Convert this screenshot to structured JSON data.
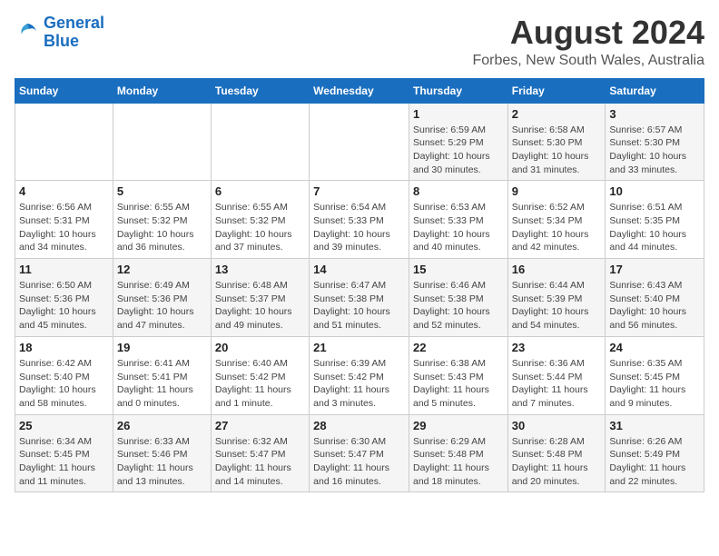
{
  "logo": {
    "line1": "General",
    "line2": "Blue"
  },
  "title": "August 2024",
  "subtitle": "Forbes, New South Wales, Australia",
  "days_of_week": [
    "Sunday",
    "Monday",
    "Tuesday",
    "Wednesday",
    "Thursday",
    "Friday",
    "Saturday"
  ],
  "weeks": [
    [
      {
        "day": "",
        "info": ""
      },
      {
        "day": "",
        "info": ""
      },
      {
        "day": "",
        "info": ""
      },
      {
        "day": "",
        "info": ""
      },
      {
        "day": "1",
        "info": "Sunrise: 6:59 AM\nSunset: 5:29 PM\nDaylight: 10 hours\nand 30 minutes."
      },
      {
        "day": "2",
        "info": "Sunrise: 6:58 AM\nSunset: 5:30 PM\nDaylight: 10 hours\nand 31 minutes."
      },
      {
        "day": "3",
        "info": "Sunrise: 6:57 AM\nSunset: 5:30 PM\nDaylight: 10 hours\nand 33 minutes."
      }
    ],
    [
      {
        "day": "4",
        "info": "Sunrise: 6:56 AM\nSunset: 5:31 PM\nDaylight: 10 hours\nand 34 minutes."
      },
      {
        "day": "5",
        "info": "Sunrise: 6:55 AM\nSunset: 5:32 PM\nDaylight: 10 hours\nand 36 minutes."
      },
      {
        "day": "6",
        "info": "Sunrise: 6:55 AM\nSunset: 5:32 PM\nDaylight: 10 hours\nand 37 minutes."
      },
      {
        "day": "7",
        "info": "Sunrise: 6:54 AM\nSunset: 5:33 PM\nDaylight: 10 hours\nand 39 minutes."
      },
      {
        "day": "8",
        "info": "Sunrise: 6:53 AM\nSunset: 5:33 PM\nDaylight: 10 hours\nand 40 minutes."
      },
      {
        "day": "9",
        "info": "Sunrise: 6:52 AM\nSunset: 5:34 PM\nDaylight: 10 hours\nand 42 minutes."
      },
      {
        "day": "10",
        "info": "Sunrise: 6:51 AM\nSunset: 5:35 PM\nDaylight: 10 hours\nand 44 minutes."
      }
    ],
    [
      {
        "day": "11",
        "info": "Sunrise: 6:50 AM\nSunset: 5:36 PM\nDaylight: 10 hours\nand 45 minutes."
      },
      {
        "day": "12",
        "info": "Sunrise: 6:49 AM\nSunset: 5:36 PM\nDaylight: 10 hours\nand 47 minutes."
      },
      {
        "day": "13",
        "info": "Sunrise: 6:48 AM\nSunset: 5:37 PM\nDaylight: 10 hours\nand 49 minutes."
      },
      {
        "day": "14",
        "info": "Sunrise: 6:47 AM\nSunset: 5:38 PM\nDaylight: 10 hours\nand 51 minutes."
      },
      {
        "day": "15",
        "info": "Sunrise: 6:46 AM\nSunset: 5:38 PM\nDaylight: 10 hours\nand 52 minutes."
      },
      {
        "day": "16",
        "info": "Sunrise: 6:44 AM\nSunset: 5:39 PM\nDaylight: 10 hours\nand 54 minutes."
      },
      {
        "day": "17",
        "info": "Sunrise: 6:43 AM\nSunset: 5:40 PM\nDaylight: 10 hours\nand 56 minutes."
      }
    ],
    [
      {
        "day": "18",
        "info": "Sunrise: 6:42 AM\nSunset: 5:40 PM\nDaylight: 10 hours\nand 58 minutes."
      },
      {
        "day": "19",
        "info": "Sunrise: 6:41 AM\nSunset: 5:41 PM\nDaylight: 11 hours\nand 0 minutes."
      },
      {
        "day": "20",
        "info": "Sunrise: 6:40 AM\nSunset: 5:42 PM\nDaylight: 11 hours\nand 1 minute."
      },
      {
        "day": "21",
        "info": "Sunrise: 6:39 AM\nSunset: 5:42 PM\nDaylight: 11 hours\nand 3 minutes."
      },
      {
        "day": "22",
        "info": "Sunrise: 6:38 AM\nSunset: 5:43 PM\nDaylight: 11 hours\nand 5 minutes."
      },
      {
        "day": "23",
        "info": "Sunrise: 6:36 AM\nSunset: 5:44 PM\nDaylight: 11 hours\nand 7 minutes."
      },
      {
        "day": "24",
        "info": "Sunrise: 6:35 AM\nSunset: 5:45 PM\nDaylight: 11 hours\nand 9 minutes."
      }
    ],
    [
      {
        "day": "25",
        "info": "Sunrise: 6:34 AM\nSunset: 5:45 PM\nDaylight: 11 hours\nand 11 minutes."
      },
      {
        "day": "26",
        "info": "Sunrise: 6:33 AM\nSunset: 5:46 PM\nDaylight: 11 hours\nand 13 minutes."
      },
      {
        "day": "27",
        "info": "Sunrise: 6:32 AM\nSunset: 5:47 PM\nDaylight: 11 hours\nand 14 minutes."
      },
      {
        "day": "28",
        "info": "Sunrise: 6:30 AM\nSunset: 5:47 PM\nDaylight: 11 hours\nand 16 minutes."
      },
      {
        "day": "29",
        "info": "Sunrise: 6:29 AM\nSunset: 5:48 PM\nDaylight: 11 hours\nand 18 minutes."
      },
      {
        "day": "30",
        "info": "Sunrise: 6:28 AM\nSunset: 5:48 PM\nDaylight: 11 hours\nand 20 minutes."
      },
      {
        "day": "31",
        "info": "Sunrise: 6:26 AM\nSunset: 5:49 PM\nDaylight: 11 hours\nand 22 minutes."
      }
    ]
  ]
}
